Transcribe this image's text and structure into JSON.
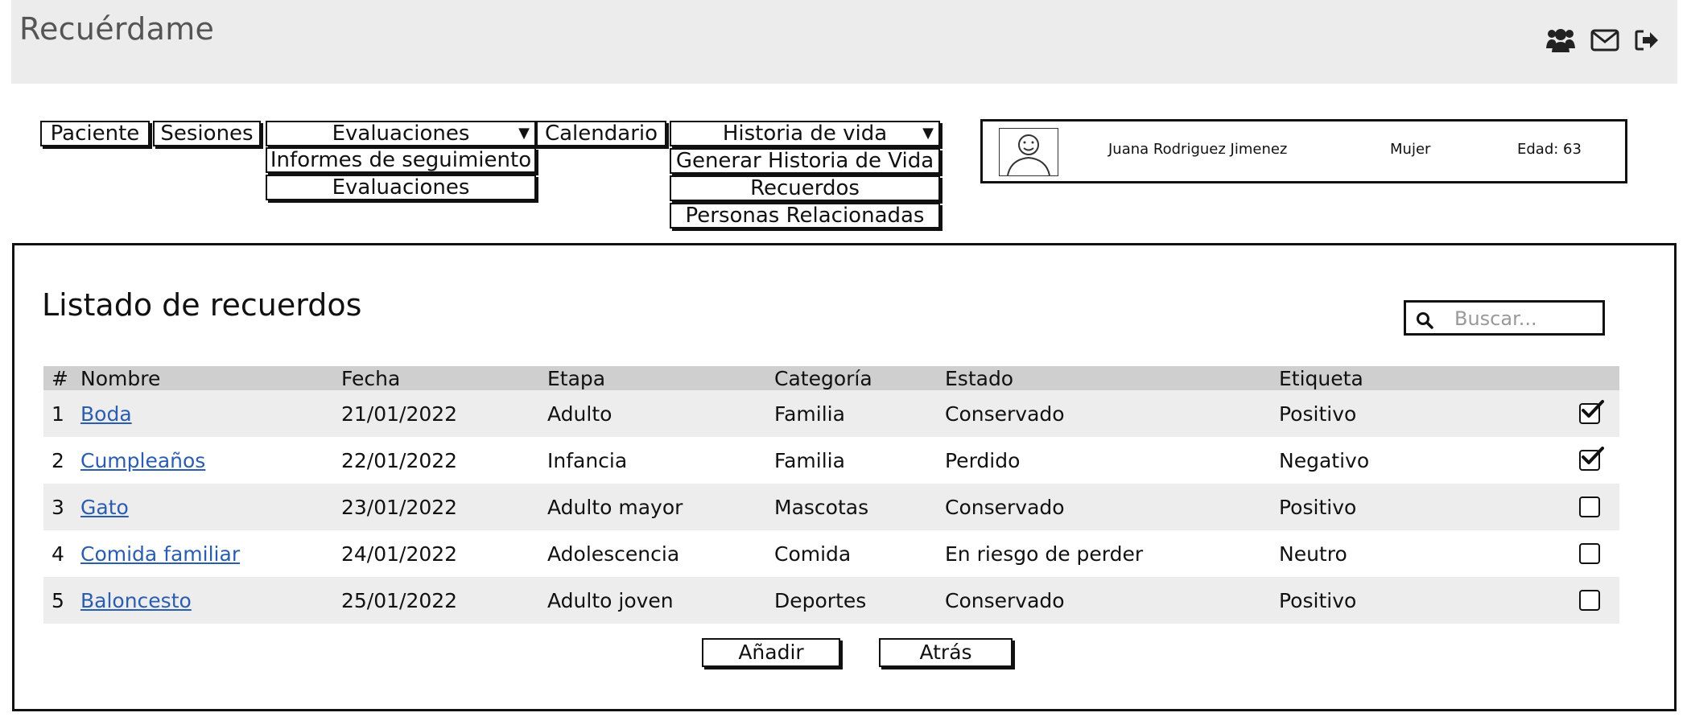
{
  "app": {
    "title": "Recuérdame"
  },
  "header_icons": [
    "users-icon",
    "mail-icon",
    "sign-out-icon"
  ],
  "menu": {
    "paciente": "Paciente",
    "sesiones": "Sesiones",
    "evaluaciones": {
      "label": "Evaluaciones",
      "arrow": "▼",
      "items": [
        "Informes de seguimiento",
        "Evaluaciones"
      ]
    },
    "calendario": "Calendario",
    "historia": {
      "label": "Historia de vida",
      "arrow": "▼",
      "items": [
        "Generar Historia de Vida",
        "Recuerdos",
        "Personas Relacionadas"
      ]
    }
  },
  "patient": {
    "name": "Juana Rodriguez Jimenez",
    "gender": "Mujer",
    "age": "Edad: 63"
  },
  "main": {
    "title": "Listado de recuerdos",
    "search_placeholder": "Buscar...",
    "headers": {
      "num": "#",
      "name": "Nombre",
      "date": "Fecha",
      "stage": "Etapa",
      "category": "Categoría",
      "state": "Estado",
      "tag": "Etiqueta"
    },
    "rows": [
      {
        "num": "1",
        "name": "Boda",
        "date": "21/01/2022",
        "stage": "Adulto",
        "category": "Familia",
        "state": "Conservado",
        "tag": "Positivo",
        "checked": true
      },
      {
        "num": "2",
        "name": "Cumpleaños",
        "date": "22/01/2022",
        "stage": "Infancia",
        "category": "Familia",
        "state": "Perdido",
        "tag": "Negativo",
        "checked": true
      },
      {
        "num": "3",
        "name": "Gato",
        "date": "23/01/2022",
        "stage": "Adulto mayor",
        "category": "Mascotas",
        "state": "Conservado",
        "tag": "Positivo",
        "checked": false
      },
      {
        "num": "4",
        "name": "Comida familiar",
        "date": "24/01/2022",
        "stage": "Adolescencia",
        "category": "Comida",
        "state": "En riesgo de perder",
        "tag": "Neutro",
        "checked": false
      },
      {
        "num": "5",
        "name": "Baloncesto",
        "date": "25/01/2022",
        "stage": "Adulto joven",
        "category": "Deportes",
        "state": "Conservado",
        "tag": "Positivo",
        "checked": false
      }
    ],
    "buttons": {
      "add": "Añadir",
      "back": "Atrás"
    }
  },
  "colors": {
    "link": "#2a5db0",
    "header_bg": "#ececec",
    "table_head": "#cfcfcf",
    "row_alt": "#ededed"
  }
}
